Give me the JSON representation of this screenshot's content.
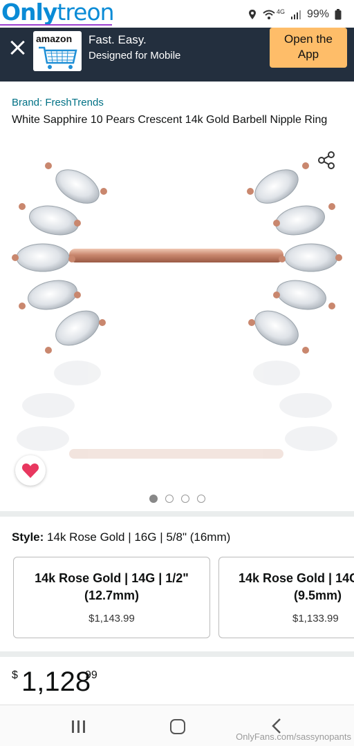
{
  "watermark": {
    "logo_part1": "Only",
    "logo_part2": "treon",
    "footer": "OnlyFans.com/sassynopants"
  },
  "status_bar": {
    "network": "4G",
    "battery": "99%"
  },
  "banner": {
    "logo_text": "amazon",
    "title": "Fast. Easy.",
    "subtitle": "Designed for Mobile",
    "open_button": "Open the App",
    "colors": {
      "background": "#232f3e",
      "button": "#febd69"
    }
  },
  "product": {
    "brand": "Brand: FreshTrends",
    "title": "White Sapphire 10 Pears Crescent 14k Gold Barbell Nipple Ring",
    "image_alt_icon": "rose-gold-barbell-image",
    "carousel_dots": 4,
    "active_dot": 0
  },
  "style": {
    "label": "Style:",
    "value": "14k Rose Gold | 16G | 5/8\" (16mm)",
    "options": [
      {
        "title_line1": "14k Rose Gold | 14G | 1/2\"",
        "title_line2": "(12.7mm)",
        "price": "$1,143.99"
      },
      {
        "title_line1": "14k Rose Gold | 14G",
        "title_line2": "(9.5mm)",
        "price": "$1,133.99"
      }
    ]
  },
  "price": {
    "symbol": "$",
    "whole": "1,128",
    "fraction": "99"
  },
  "colors": {
    "link": "#007185",
    "heart": "#e8375f",
    "rose_gold": "#c9876e"
  }
}
